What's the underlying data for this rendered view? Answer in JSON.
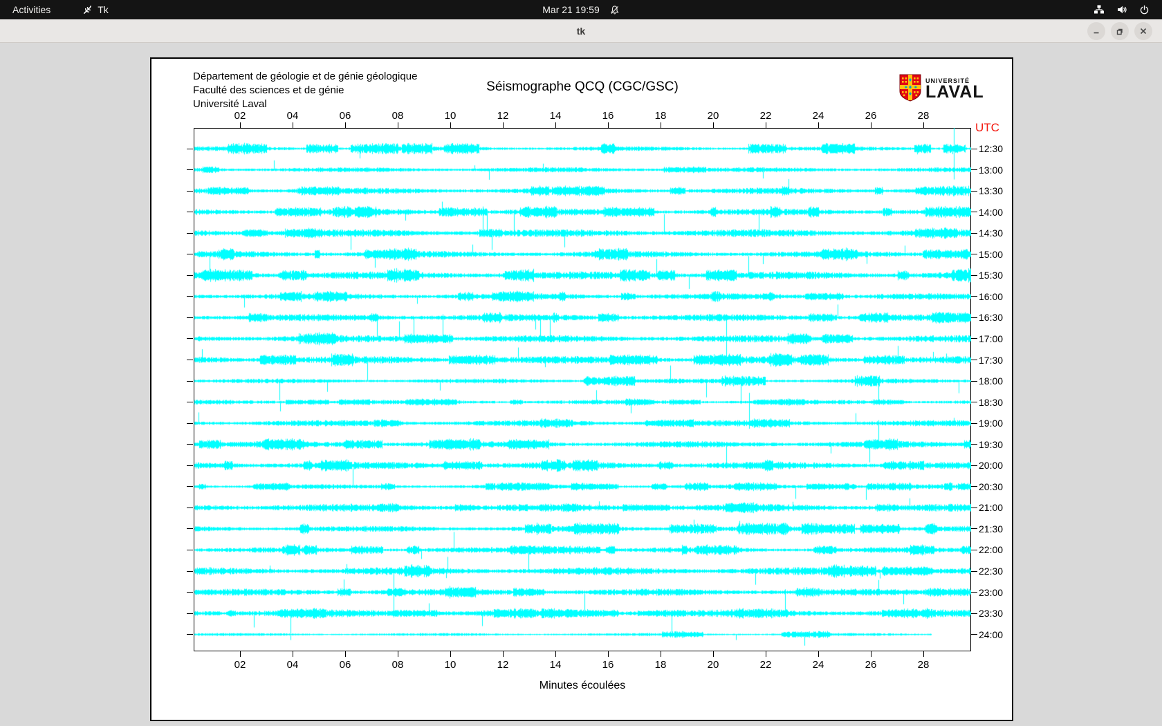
{
  "os_bar": {
    "activities": "Activities",
    "app_name": "Tk",
    "clock": "Mar 21 19:59"
  },
  "window": {
    "title": "tk"
  },
  "figure": {
    "header_lines": [
      "Département de géologie et de génie géologique",
      "Faculté des sciences et de génie",
      "Université Laval"
    ],
    "title": "Séismographe QCQ (CGC/GSC)",
    "logo_line1": "UNIVERSITÉ",
    "logo_line2": "LAVAL",
    "utc_label": "UTC",
    "xlabel": "Minutes écoulées",
    "colors": {
      "trace": "#00FFFF",
      "utc_label": "#F3170D",
      "logo_red": "#E30513",
      "logo_gold": "#FFC20E",
      "logo_blue": "#00A0D2"
    }
  },
  "chart_data": {
    "type": "line",
    "description": "Helicorder seismogram drum plot: 24 half-hour rows of continuous cyan seismic noise traces with intermittent spikes and bursts; last row (24:00) only partially recorded",
    "title": "Séismographe QCQ (CGC/GSC)",
    "x_tick_labels": [
      "02",
      "04",
      "06",
      "08",
      "10",
      "12",
      "14",
      "16",
      "18",
      "20",
      "22",
      "24",
      "26",
      "28"
    ],
    "x_axis_minutes_range": [
      0,
      29.5
    ],
    "x_axis_label": "Minutes écoulées",
    "right_axis_title": "UTC",
    "row_time_labels_utc": [
      "12:30",
      "13:00",
      "13:30",
      "14:00",
      "14:30",
      "15:00",
      "15:30",
      "16:00",
      "16:30",
      "17:00",
      "17:30",
      "18:00",
      "18:30",
      "19:00",
      "19:30",
      "20:00",
      "20:30",
      "21:00",
      "21:30",
      "22:00",
      "22:30",
      "23:00",
      "23:30",
      "24:00"
    ],
    "trace_color": "#00FFFF",
    "grid": false,
    "last_row_partial_fraction": 0.95
  }
}
